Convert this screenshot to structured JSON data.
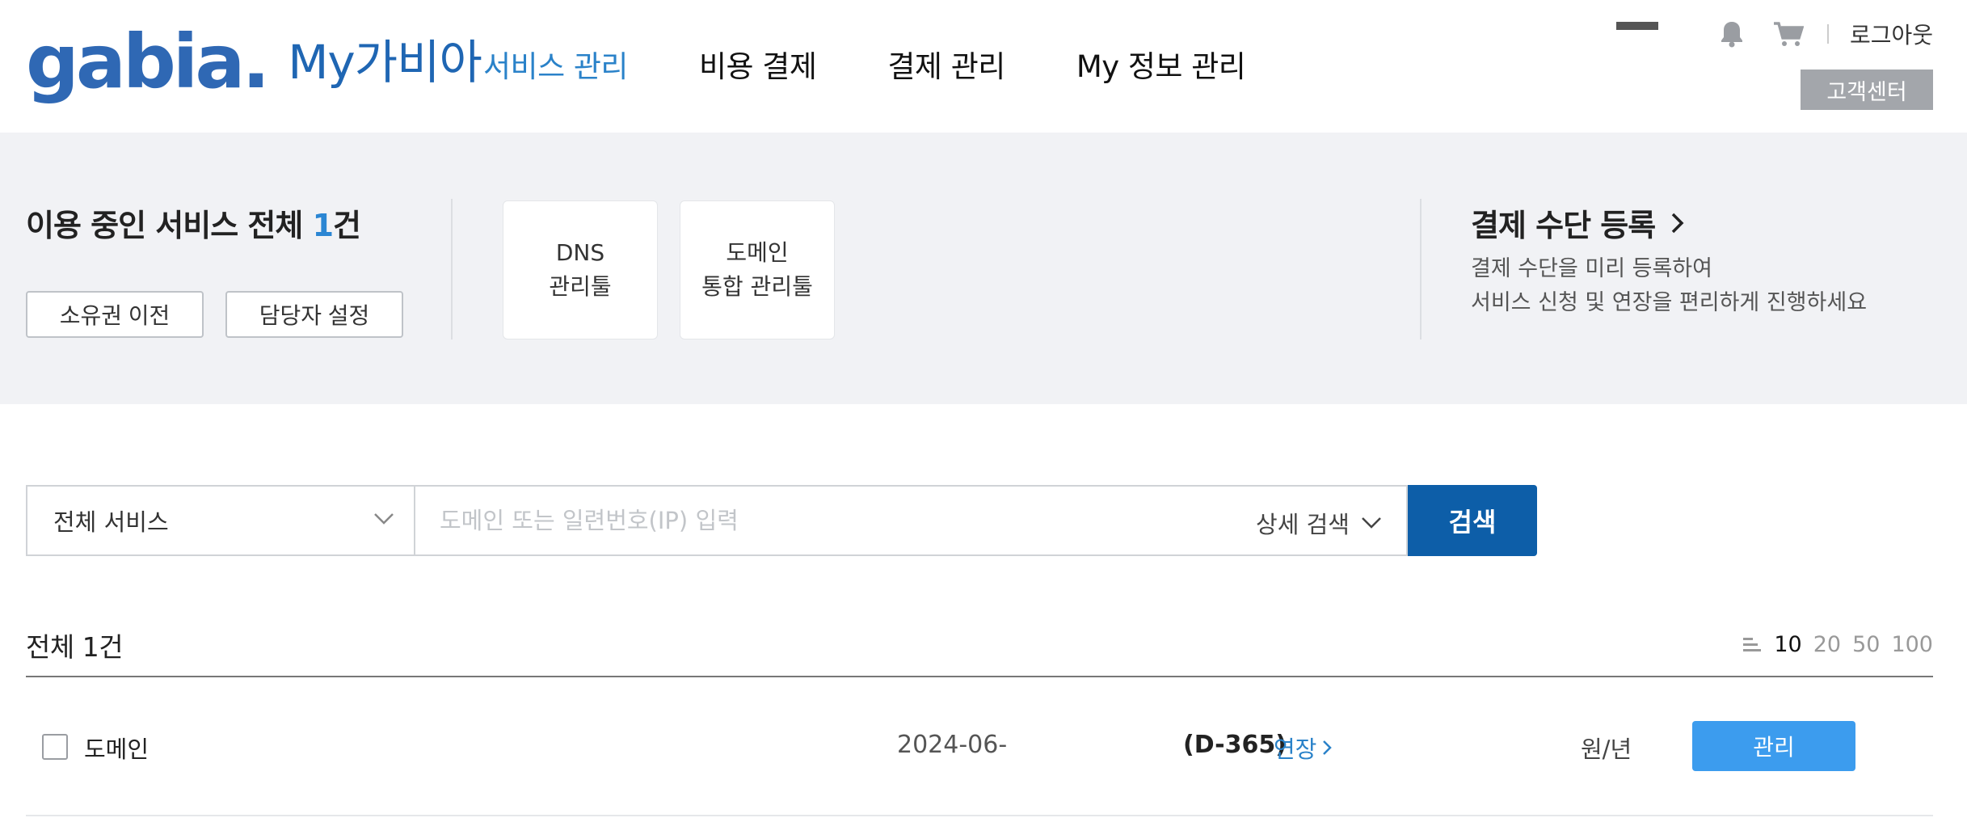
{
  "header": {
    "logo_text": "gabia.",
    "logo_sub": "My가비아",
    "nav": [
      {
        "label": "서비스 관리",
        "active": true
      },
      {
        "label": "비용 결제",
        "active": false
      },
      {
        "label": "결제 관리",
        "active": false
      },
      {
        "label": "My 정보 관리",
        "active": false
      }
    ],
    "logout_label": "로그아웃",
    "customer_center_label": "고객센터",
    "icons": [
      "bell-icon",
      "cart-icon"
    ]
  },
  "summary": {
    "title_prefix": "이용 중인 서비스 전체 ",
    "title_count": "1",
    "title_suffix": "건",
    "transfer_label": "소유권 이전",
    "manager_label": "담당자 설정",
    "tools": [
      {
        "line1": "DNS",
        "line2": "관리툴"
      },
      {
        "line1": "도메인",
        "line2": "통합 관리툴"
      }
    ],
    "payment_title": "결제 수단 등록",
    "payment_desc_line1": "결제 수단을 미리 등록하여",
    "payment_desc_line2": "서비스 신청 및 연장을 편리하게 진행하세요"
  },
  "search": {
    "service_select_value": "전체 서비스",
    "placeholder": "도메인 또는 일련번호(IP) 입력",
    "detail_label": "상세 검색",
    "button_label": "검색"
  },
  "list": {
    "total_label": "전체 1건",
    "page_sizes": [
      {
        "label": "10",
        "selected": true
      },
      {
        "label": "20",
        "selected": false
      },
      {
        "label": "50",
        "selected": false
      },
      {
        "label": "100",
        "selected": false
      }
    ],
    "rows": [
      {
        "name": "도메인",
        "date": "2024-06-",
        "dday": "(D-365)",
        "renew_label": "연장",
        "price": "원/년",
        "manage_label": "관리"
      }
    ]
  },
  "colors": {
    "accent_blue": "#2a82c9",
    "search_button": "#0d5ea8",
    "manage_button": "#3c9cee",
    "banner_bg": "#f1f2f5"
  }
}
